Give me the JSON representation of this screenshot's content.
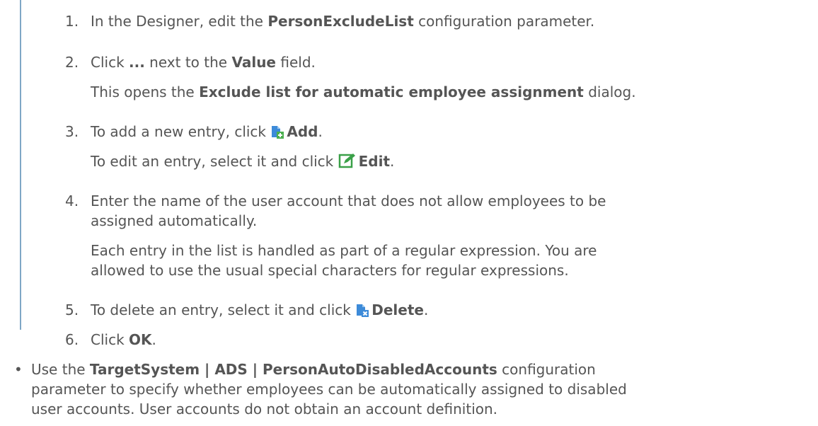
{
  "steps": [
    {
      "num": "1.",
      "pre": "In the Designer, edit the ",
      "bold": "PersonExcludeList",
      "post": " configuration parameter."
    },
    {
      "num": "2.",
      "pre": "Click ",
      "bold": "...",
      "mid": " next to the ",
      "bold2": "Value",
      "post": " field."
    },
    {
      "note_pre": "This opens the ",
      "note_bold": "Exclude list for automatic employee assignment",
      "note_post": " dialog."
    },
    {
      "num": "3.",
      "pre": "To add a new entry, click ",
      "bold": "Add",
      "post": ".",
      "icon": "add-document-icon"
    },
    {
      "note_pre": "To edit an entry, select it and click ",
      "note_bold": "Edit",
      "note_post": ".",
      "icon": "edit-pencil-icon"
    },
    {
      "num": "4.",
      "line1": "Enter the name of the user account that does not allow employees to be",
      "line2": "assigned automatically."
    },
    {
      "line1": "Each entry in the list is handled as part of a regular expression. You are",
      "line2": "allowed to use the usual special characters for regular expressions."
    },
    {
      "num": "5.",
      "pre": "To delete an entry, select it and click ",
      "bold": "Delete",
      "post": ".",
      "icon": "delete-document-icon"
    },
    {
      "num": "6.",
      "pre": "Click ",
      "bold": "OK",
      "post": "."
    }
  ],
  "bullet": {
    "symbol": "•",
    "pre": "Use the ",
    "bold": "TargetSystem | ADS | PersonAutoDisabledAccounts",
    "post": " configuration",
    "line2": "parameter to specify whether employees can be automatically assigned to disabled",
    "line3": "user accounts. User accounts do not obtain an account definition."
  }
}
